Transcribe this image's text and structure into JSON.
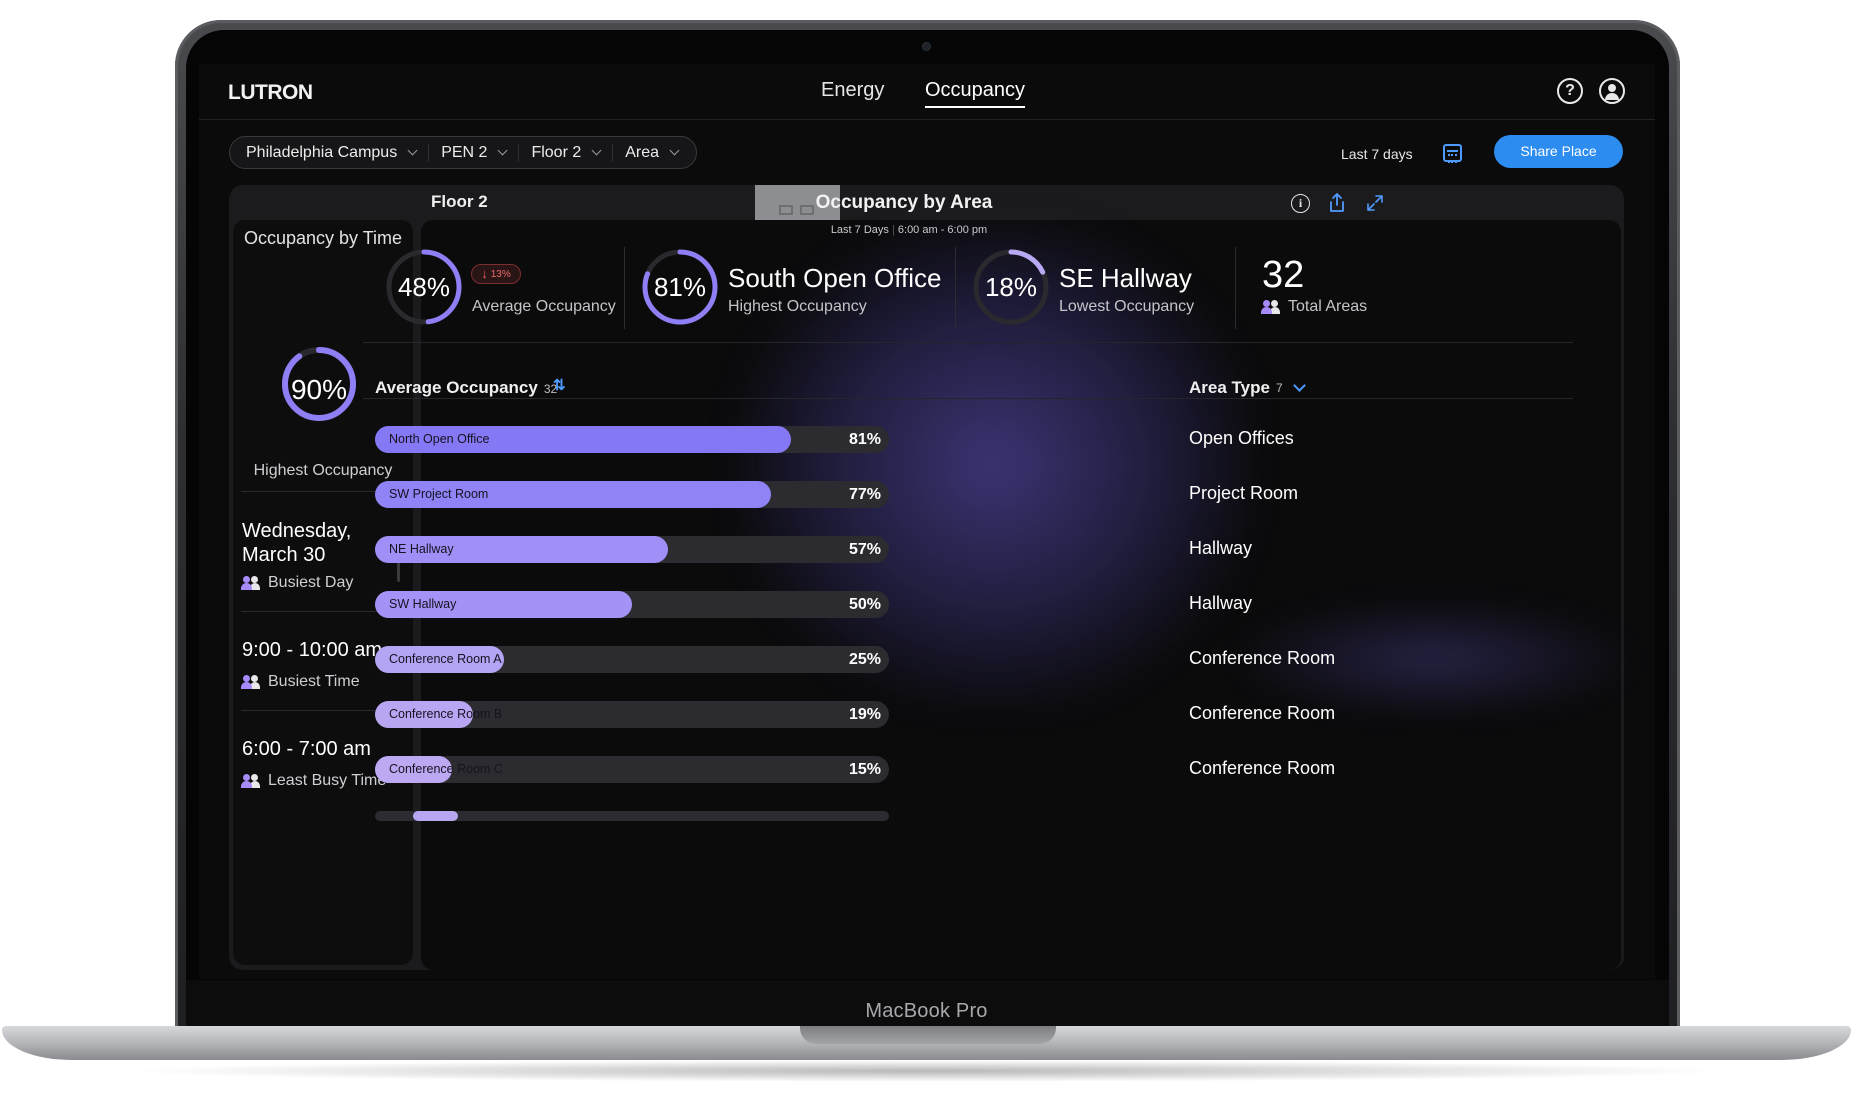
{
  "device": {
    "model_label": "MacBook Pro"
  },
  "brand": "LUTRON",
  "nav": {
    "tabs": [
      {
        "label": "Energy"
      },
      {
        "label": "Occupancy"
      }
    ]
  },
  "icons": {
    "help": "help-circle-icon",
    "user": "user-account-icon",
    "calendar": "calendar-icon",
    "info": "info-icon",
    "share": "share-icon",
    "expand": "expand-icon",
    "sort": "sort-arrows-icon"
  },
  "breadcrumb": [
    {
      "label": "Philadelphia Campus"
    },
    {
      "label": "PEN 2"
    },
    {
      "label": "Floor 2"
    },
    {
      "label": "Area"
    }
  ],
  "toolbar": {
    "date_range": "Last 7 days",
    "share_label": "Share Place"
  },
  "left_panel": {
    "title": "Occupancy by Time",
    "highest_value": "90%",
    "highest_fraction": 0.9,
    "highest_label": "Highest Occupancy",
    "stats": [
      {
        "value": "Wednesday, March 30",
        "label": "Busiest Day"
      },
      {
        "value": "9:00 - 10:00 am",
        "label": "Busiest Time"
      },
      {
        "value": "6:00 - 7:00 am",
        "label": "Least Busy Time"
      }
    ]
  },
  "main": {
    "floor": "Floor 2",
    "title": "Occupancy by Area",
    "range": {
      "days": "Last 7 Days",
      "hours": "6:00 am - 6:00 pm"
    },
    "kpis": {
      "average": {
        "value": "48%",
        "fraction": 0.48,
        "label": "Average Occupancy",
        "change": "13%"
      },
      "highest": {
        "value": "81%",
        "fraction": 0.81,
        "name": "South Open Office",
        "label": "Highest Occupancy"
      },
      "lowest": {
        "value": "18%",
        "fraction": 0.18,
        "name": "SE Hallway",
        "label": "Lowest Occupancy"
      },
      "total": {
        "value": "32",
        "label": "Total Areas"
      }
    },
    "list_header": {
      "label": "Average Occupancy",
      "count": "32"
    },
    "area_type_header": {
      "label": "Area Type",
      "count": "7"
    },
    "rows": [
      {
        "name": "North Open Office",
        "pct": "81%",
        "value": 81,
        "type": "Open Offices",
        "color": "#8578f5"
      },
      {
        "name": "SW Project Room",
        "pct": "77%",
        "value": 77,
        "type": "Project Room",
        "color": "#8f83f6"
      },
      {
        "name": "NE Hallway",
        "pct": "57%",
        "value": 57,
        "type": "Hallway",
        "color": "#a08ff7"
      },
      {
        "name": "SW Hallway",
        "pct": "50%",
        "value": 50,
        "type": "Hallway",
        "color": "#a592f6"
      },
      {
        "name": "Conference Room A",
        "pct": "25%",
        "value": 25,
        "type": "Conference Room",
        "color": "#b5a3f4"
      },
      {
        "name": "Conference Room B",
        "pct": "19%",
        "value": 19,
        "type": "Conference Room",
        "color": "#b9a6f3"
      },
      {
        "name": "Conference Room C",
        "pct": "15%",
        "value": 15,
        "type": "Conference Room",
        "color": "#bca9f2"
      }
    ]
  },
  "colors": {
    "accent_blue": "#2d8cf0",
    "ring_purple": "#8f7ff5",
    "decline_red": "#ef5c5c"
  }
}
